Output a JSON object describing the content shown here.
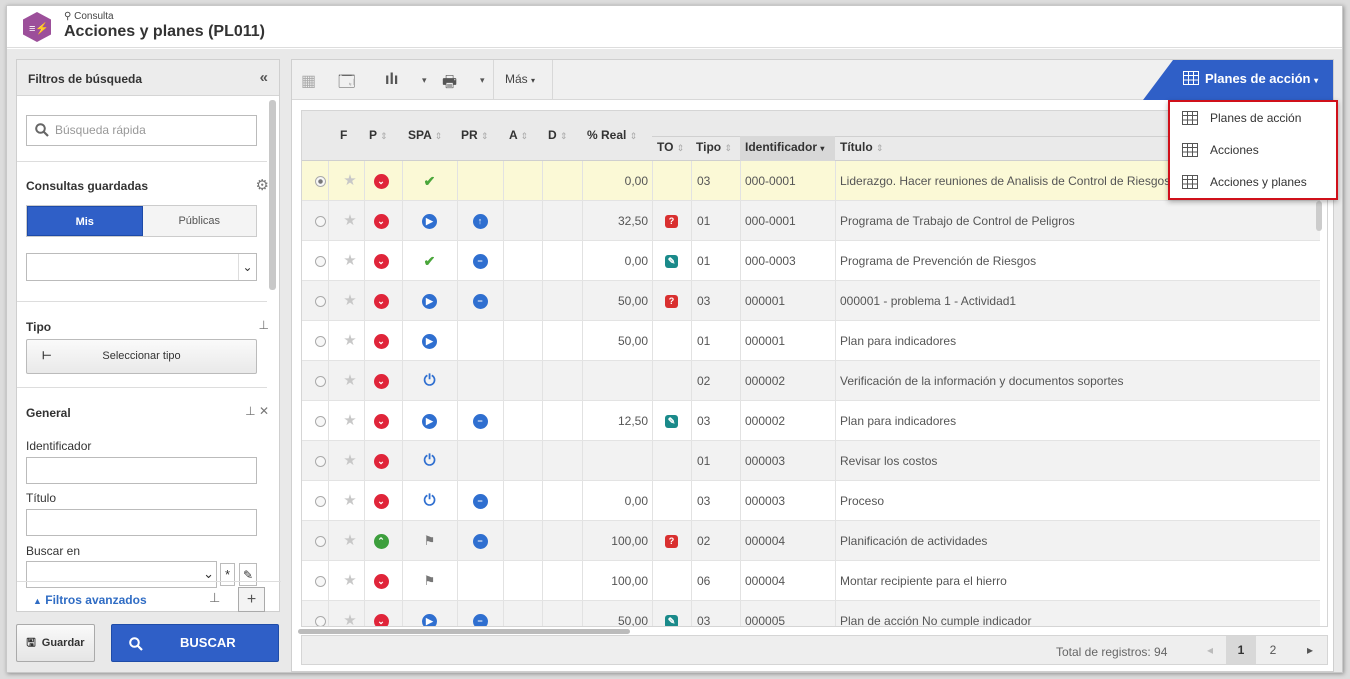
{
  "header": {
    "subtitle": "Consulta",
    "title": "Acciones y planes (PL011)"
  },
  "filters": {
    "title": "Filtros de búsqueda",
    "collapse_icon": "double-chevron-left-icon",
    "quick_search_placeholder": "Búsqueda rápida",
    "saved_queries": "Consultas guardadas",
    "tab_mine": "Mis",
    "tab_public": "Públicas",
    "type_label": "Tipo",
    "select_type": "Seleccionar tipo",
    "general_label": "General",
    "identifier_label": "Identificador",
    "title_label": "Título",
    "search_in_label": "Buscar en",
    "advanced": "Filtros avanzados",
    "save_button": "Guardar",
    "search_button": "BUSCAR"
  },
  "toolbar": {
    "more": "Más",
    "plans_button": "Planes de acción"
  },
  "menu": {
    "items": [
      "Planes de acción",
      "Acciones",
      "Acciones y planes"
    ]
  },
  "columns": [
    "F",
    "P",
    "SPA",
    "PR",
    "A",
    "D",
    "% Real",
    "TO",
    "Tipo",
    "Identificador",
    "Título"
  ],
  "rows": [
    {
      "real": "0,00",
      "tipo": "03",
      "id": "000-0001",
      "titulo": "Liderazgo. Hacer reuniones de Analisis de Control de Riesgos",
      "p": "down",
      "spa": "check-clock",
      "pr": "",
      "to": ""
    },
    {
      "real": "32,50",
      "tipo": "01",
      "id": "000-0001",
      "titulo": "Programa de Trabajo de Control de Peligros",
      "p": "down",
      "spa": "play",
      "pr": "up",
      "to": "red"
    },
    {
      "real": "0,00",
      "tipo": "01",
      "id": "000-0003",
      "titulo": "Programa de Prevención de Riesgos",
      "p": "down",
      "spa": "check-clock",
      "pr": "minus",
      "to": "teal"
    },
    {
      "real": "50,00",
      "tipo": "03",
      "id": "000001",
      "titulo": "000001 - problema 1 - Actividad1",
      "p": "down",
      "spa": "play",
      "pr": "minus",
      "to": "red"
    },
    {
      "real": "50,00",
      "tipo": "01",
      "id": "000001",
      "titulo": "Plan para indicadores",
      "p": "down",
      "spa": "play",
      "pr": "",
      "to": ""
    },
    {
      "real": "",
      "tipo": "02",
      "id": "000002",
      "titulo": "Verificación de la información y documentos soportes",
      "p": "down",
      "spa": "power",
      "pr": "",
      "to": ""
    },
    {
      "real": "12,50",
      "tipo": "03",
      "id": "000002",
      "titulo": "Plan para indicadores",
      "p": "down",
      "spa": "play",
      "pr": "minus",
      "to": "teal"
    },
    {
      "real": "",
      "tipo": "01",
      "id": "000003",
      "titulo": "Revisar los costos",
      "p": "down",
      "spa": "power",
      "pr": "",
      "to": ""
    },
    {
      "real": "0,00",
      "tipo": "03",
      "id": "000003",
      "titulo": "Proceso",
      "p": "down",
      "spa": "power",
      "pr": "minus",
      "to": ""
    },
    {
      "real": "100,00",
      "tipo": "02",
      "id": "000004",
      "titulo": "Planificación de actividades",
      "p": "up",
      "spa": "flag",
      "pr": "minus",
      "to": "red"
    },
    {
      "real": "100,00",
      "tipo": "06",
      "id": "000004",
      "titulo": "Montar recipiente para el hierro",
      "p": "down",
      "spa": "flag",
      "pr": "",
      "to": ""
    },
    {
      "real": "50,00",
      "tipo": "03",
      "id": "000005",
      "titulo": "Plan de acción No cumple indicador",
      "p": "down",
      "spa": "play",
      "pr": "minus",
      "to": "teal"
    }
  ],
  "footer": {
    "total": "Total de registros: 94",
    "pages": [
      "1",
      "2"
    ]
  }
}
